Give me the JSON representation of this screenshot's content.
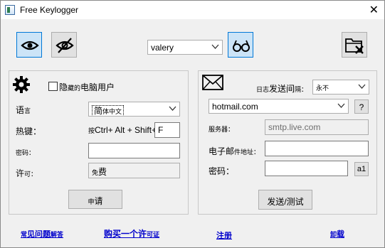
{
  "window": {
    "title": "Free Keylogger",
    "close_glyph": "✕"
  },
  "toolbar": {
    "user_select": "valery",
    "icons": [
      "eye-icon",
      "eye-off-icon",
      "glasses-icon",
      "folder-x-icon"
    ]
  },
  "left": {
    "hide_users_prefix": "隐",
    "hide_users_small": "藏的",
    "hide_users_suffix": "电脑用户",
    "language_label_big": "语",
    "language_label_small": "言",
    "language_value_big": "简",
    "language_value_small": "体中文",
    "hotkey_label": "热键：",
    "hotkey_prefix_small": "按",
    "hotkey_prefix": "Ctrl+ Alt + Shift+",
    "hotkey_value": "F",
    "password_label_small": "密码：",
    "license_label_big": "许",
    "license_label_small": "可：",
    "license_value_big": "免",
    "license_value_small": "费",
    "apply_small": "申",
    "apply_big": "请"
  },
  "right": {
    "log_interval_small1": "日志",
    "log_interval_big": "发送间",
    "log_interval_small2": "隔：",
    "log_interval_value_small": "永",
    "log_interval_value_small2": "不",
    "provider_select": "hotmail.com",
    "help_button": "?",
    "server_label": "服务器：",
    "server_value": "smtp.live.com",
    "email_label_big": "电子邮",
    "email_label_small": "件地址：",
    "password_label": "密码：",
    "a1_button": "a1",
    "send_test_button": "发送/测试"
  },
  "footer": {
    "faq_small1": "常",
    "faq_big": "见问题",
    "faq_small2": "解答",
    "buy_big": "购买一个许",
    "buy_small": "可证",
    "register": "注册",
    "uninstall_small": "卸",
    "uninstall_big": "载"
  },
  "colors": {
    "accent": "#0078d7",
    "link": "#0000cc",
    "active_fill": "#cce4f7"
  }
}
